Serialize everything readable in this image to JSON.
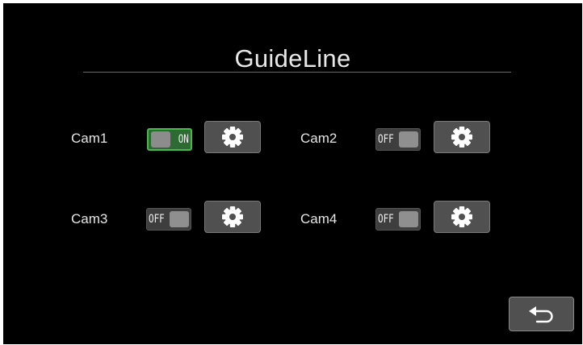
{
  "title": "GuideLine",
  "icons": {
    "settings": "gear-icon",
    "back": "return-arrow-icon"
  },
  "colors": {
    "toggle_on_accent": "#48b84f",
    "toggle_on_fill": "#2e6b33",
    "button_fill": "#505050"
  },
  "cameras": [
    {
      "label": "Cam1",
      "enabled": true,
      "state_text": "ON"
    },
    {
      "label": "Cam2",
      "enabled": false,
      "state_text": "OFF"
    },
    {
      "label": "Cam3",
      "enabled": false,
      "state_text": "OFF"
    },
    {
      "label": "Cam4",
      "enabled": false,
      "state_text": "OFF"
    }
  ]
}
